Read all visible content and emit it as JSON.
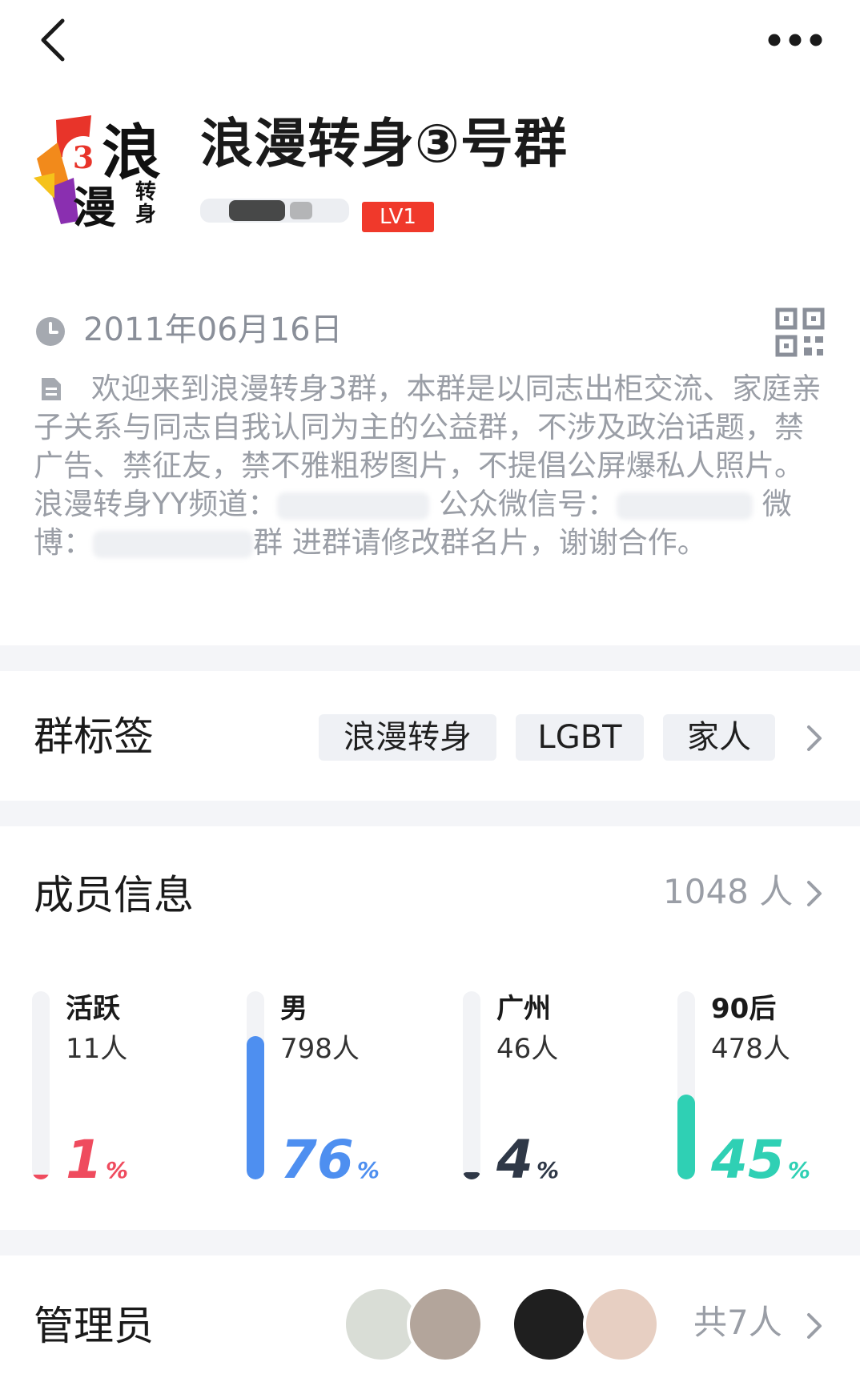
{
  "topbar": {
    "back_icon": "chevron-left-icon",
    "more_icon": "more-horizontal-icon"
  },
  "group": {
    "name": "浪漫转身③号群",
    "level": "LV1",
    "created_date": "2011年06月16日",
    "description_parts": [
      "欢迎来到浪漫转身3群，本群是以同志出柜交流、家庭亲子关系与同志自我认同为主的公益群，不涉及政治话题，禁广告、禁征友，禁不雅粗秽图片，不提倡公屏爆私人照片。 浪漫转身YY频道：",
      " 公众微信号：",
      " 微博：",
      "群 进群请修改群名片，谢谢合作。"
    ]
  },
  "tags": {
    "label": "群标签",
    "items": [
      "浪漫转身",
      "LGBT",
      "家人"
    ]
  },
  "members": {
    "label": "成员信息",
    "count": "1048 人",
    "stats": [
      {
        "label": "活跃",
        "count": "11人",
        "percent": 1,
        "color": "#ef4b5e"
      },
      {
        "label": "男",
        "count": "798人",
        "percent": 76,
        "color": "#4e8ff0"
      },
      {
        "label": "广州",
        "count": "46人",
        "percent": 4,
        "color": "#2f3847"
      },
      {
        "label": "90后",
        "count": "478人",
        "percent": 45,
        "color": "#2fd0b4"
      }
    ],
    "percent_unit": "%"
  },
  "admins": {
    "label": "管理员",
    "count": "共7人"
  }
}
